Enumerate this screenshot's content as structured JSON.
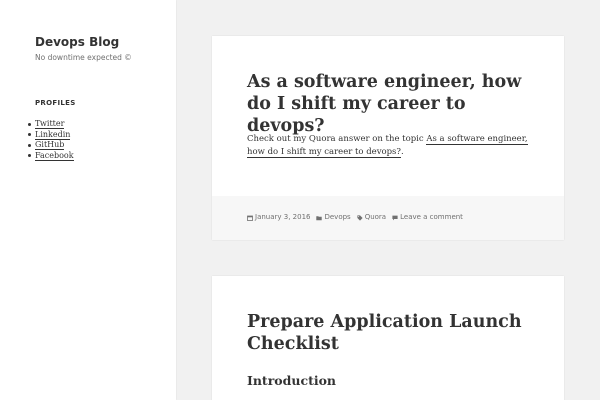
{
  "site": {
    "title": "Devops Blog",
    "description": "No downtime expected ©"
  },
  "sidebar": {
    "profiles_title": "PROFILES",
    "profiles": [
      {
        "label": "Twitter"
      },
      {
        "label": "Linkedin"
      },
      {
        "label": "GitHub"
      },
      {
        "label": "Facebook"
      }
    ]
  },
  "posts": [
    {
      "title": "As a software engineer, how do I shift my career to devops?",
      "body_prefix": "Check out my Quora answer on the topic ",
      "body_link": "As a software engineer, how do I shift my career to devops?",
      "body_suffix": ".",
      "meta": {
        "date": "January 3, 2016",
        "category": "Devops",
        "tag": "Quora",
        "comments": "Leave a comment"
      },
      "icons": {
        "date": "calendar-icon",
        "category": "folder-icon",
        "tag": "tag-icon",
        "comments": "comment-icon"
      }
    },
    {
      "title": "Prepare Application Launch Checklist",
      "section_heading": "Introduction"
    }
  ],
  "colors": {
    "background": "#f1f1f1",
    "card": "#ffffff",
    "footer": "#f7f7f7",
    "text": "#333333",
    "muted": "#707070"
  }
}
